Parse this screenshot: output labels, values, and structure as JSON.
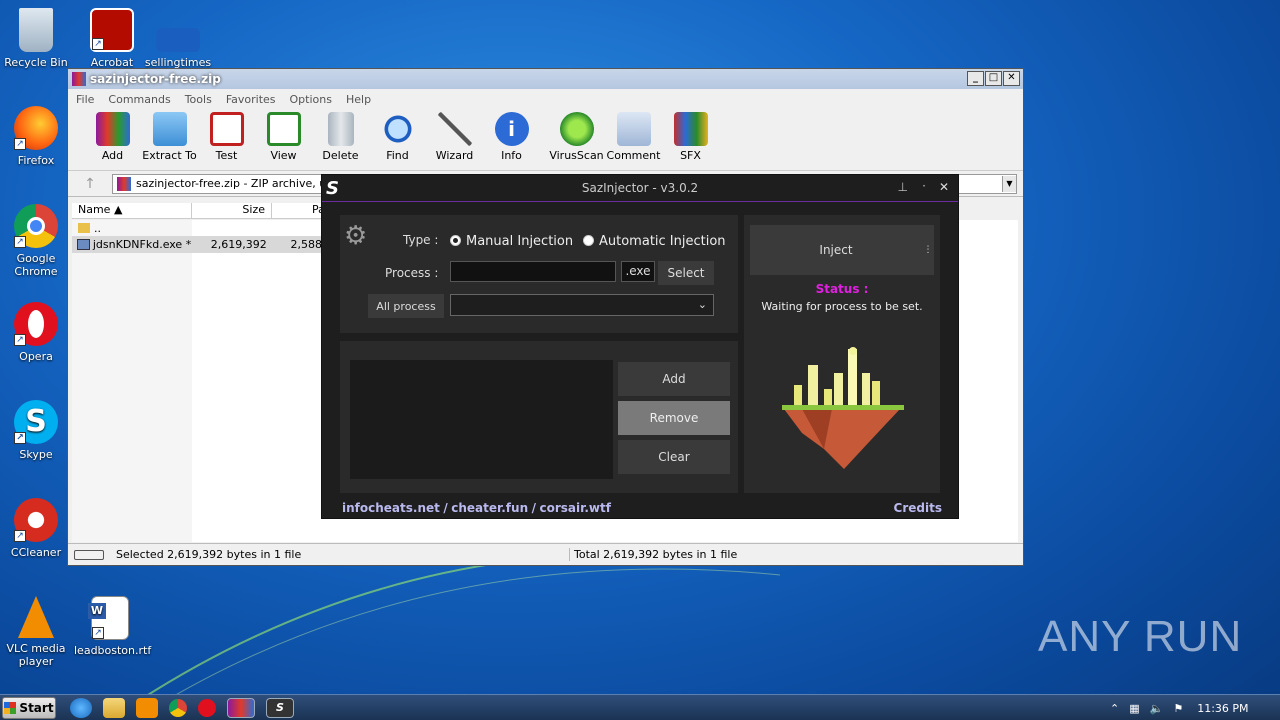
{
  "desktop": {
    "icons": [
      {
        "label": "Recycle Bin"
      },
      {
        "label": "Acrobat"
      },
      {
        "label": "sellingtimes"
      },
      {
        "label": "Firefox"
      },
      {
        "label": "Google Chrome"
      },
      {
        "label": "Opera"
      },
      {
        "label": "Skype"
      },
      {
        "label": "CCleaner"
      },
      {
        "label": "VLC media player"
      },
      {
        "label": "leadboston.rtf"
      }
    ],
    "watermark": "ANY RUN"
  },
  "winrar": {
    "title": "sazinjector-free.zip",
    "menu": [
      "File",
      "Commands",
      "Tools",
      "Favorites",
      "Options",
      "Help"
    ],
    "toolbar": [
      "Add",
      "Extract To",
      "Test",
      "View",
      "Delete",
      "Find",
      "Wizard",
      "Info",
      "VirusScan",
      "Comment",
      "SFX"
    ],
    "address": "sazinjector-free.zip - ZIP archive, un",
    "columns": {
      "name": "Name",
      "size": "Size",
      "packed": "Pa"
    },
    "rows": [
      {
        "name": "..",
        "size": "",
        "packed": ""
      },
      {
        "name": "jdsnKDNFkd.exe *",
        "size": "2,619,392",
        "packed": "2,588"
      }
    ],
    "status_left": "Selected 2,619,392 bytes in 1 file",
    "status_right": "Total 2,619,392 bytes in 1 file"
  },
  "injector": {
    "title": "SazInjector - v3.0.2",
    "type_label": "Type :",
    "manual": "Manual Injection",
    "automatic": "Automatic Injection",
    "process_label": "Process :",
    "process_value": "",
    "ext": ".exe",
    "select": "Select",
    "all_process": "All process",
    "dropdown_value": "",
    "add": "Add",
    "remove": "Remove",
    "clear": "Clear",
    "inject": "Inject",
    "status_title": "Status :",
    "status_text": "Waiting for process to be set.",
    "links": [
      "infocheats.net",
      "cheater.fun",
      "corsair.wtf"
    ],
    "sep": "/",
    "credits": "Credits",
    "colors": {
      "accent": "#9b2de0",
      "status": "#e020e0"
    }
  },
  "taskbar": {
    "start": "Start",
    "clock": "11:36 PM"
  }
}
